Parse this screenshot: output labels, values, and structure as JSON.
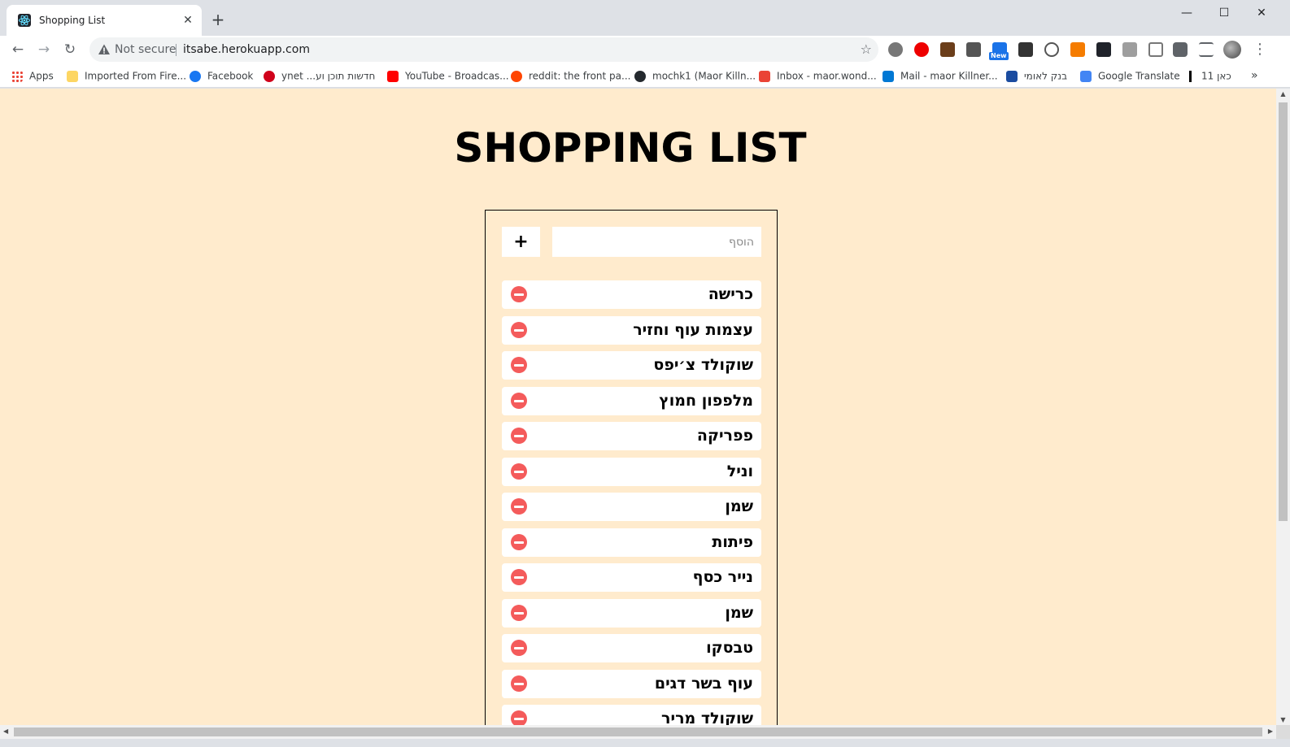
{
  "browser": {
    "tab_title": "Shopping List",
    "tab_close": "✕",
    "new_tab": "+",
    "security_label": "Not secure",
    "url": "itsabe.herokuapp.com",
    "new_badge": "New",
    "window_controls": {
      "minimize": "—",
      "maximize": "☐",
      "close": "✕"
    }
  },
  "bookmarks": [
    {
      "label": "Apps",
      "icon": "apps-grid-icon",
      "color": "#4285f4"
    },
    {
      "label": "Imported From Fire...",
      "icon": "folder-icon",
      "color": "#fdd663"
    },
    {
      "label": "Facebook",
      "icon": "facebook-icon",
      "color": "#1877f2"
    },
    {
      "label": "ynet ...חדשות תוכן וע",
      "icon": "ynet-icon",
      "color": "#d0021b"
    },
    {
      "label": "YouTube - Broadcas...",
      "icon": "youtube-icon",
      "color": "#ff0000"
    },
    {
      "label": "reddit: the front pa...",
      "icon": "reddit-icon",
      "color": "#ff4500"
    },
    {
      "label": "mochk1 (Maor Killn...",
      "icon": "github-icon",
      "color": "#24292e"
    },
    {
      "label": "Inbox - maor.wond...",
      "icon": "gmail-icon",
      "color": "#ea4335"
    },
    {
      "label": "Mail - maor Killner...",
      "icon": "outlook-icon",
      "color": "#0078d4"
    },
    {
      "label": "בנק לאומי",
      "icon": "bank-leumi-icon",
      "color": "#1b4ca0"
    },
    {
      "label": "Google Translate",
      "icon": "google-translate-icon",
      "color": "#4285f4"
    },
    {
      "label": "כאן 11",
      "icon": "kan11-icon",
      "color": "#000000"
    }
  ],
  "page": {
    "title": "SHOPPING LIST",
    "add_button_label": "+",
    "add_input_placeholder": "הוסף",
    "items": [
      "כרישה",
      "עצמות עוף וחזיר",
      "שוקולד צ׳יפס",
      "מלפפון חמוץ",
      "פפריקה",
      "וניל",
      "שמן",
      "פיתות",
      "נייר כסף",
      "שמן",
      "טבסקו",
      "עוף בשר דגים",
      "שוקולד מריר"
    ],
    "background_color": "#ffebcd",
    "remove_color": "#f45b5b"
  }
}
